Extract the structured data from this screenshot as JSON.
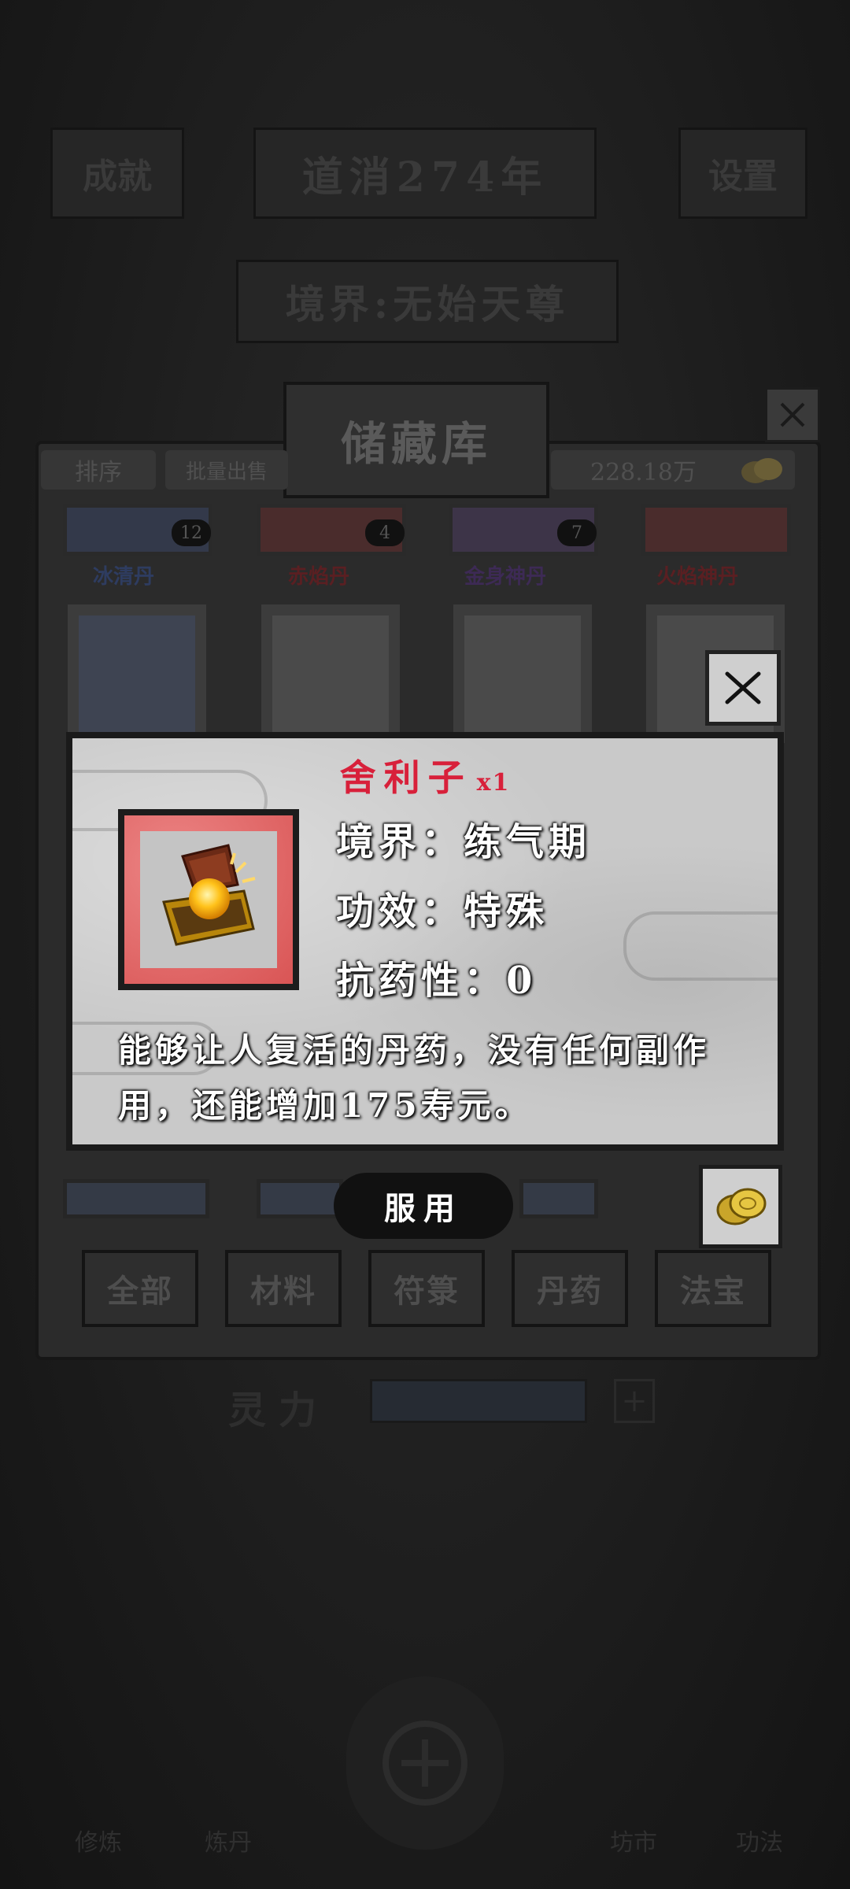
{
  "header": {
    "left_button": "成就",
    "era": "道消274年",
    "right_button": "设置",
    "realm": "境界:无始天尊"
  },
  "storage": {
    "title": "储藏库",
    "sort_label": "排序",
    "batch_sell_label": "批量出售",
    "currency_amount": "228.18万",
    "top_items": [
      {
        "name": "冰清丹",
        "count": "12",
        "color": "#3a4a6a"
      },
      {
        "name": "赤焰丹",
        "count": "4",
        "color": "#5a2a2a"
      },
      {
        "name": "金身神丹",
        "count": "7",
        "color": "#4a3a6a"
      },
      {
        "name": "火焰神丹",
        "count": "",
        "color": "#5a2a2a"
      }
    ],
    "tabs": [
      "全部",
      "材料",
      "符箓",
      "丹药",
      "法宝"
    ]
  },
  "power": {
    "label": "灵力"
  },
  "bottom_nav": [
    "修炼",
    "炼丹",
    "",
    "坊市",
    "功法"
  ],
  "dialog": {
    "item_name": "舍利子",
    "item_qty": "x1",
    "realm_line": "境界：练气期",
    "effect_line": "功效：特殊",
    "resistance_line": "抗药性：0",
    "description": "能够让人复活的丹药，没有任何副作用，还能增加175寿元。",
    "use_button": "服用",
    "frame_color": "#e46e6e",
    "title_color": "#d8203a"
  },
  "icons": {
    "close": "close-icon",
    "coin": "coin-icon",
    "item": "treasure-chest-icon"
  }
}
